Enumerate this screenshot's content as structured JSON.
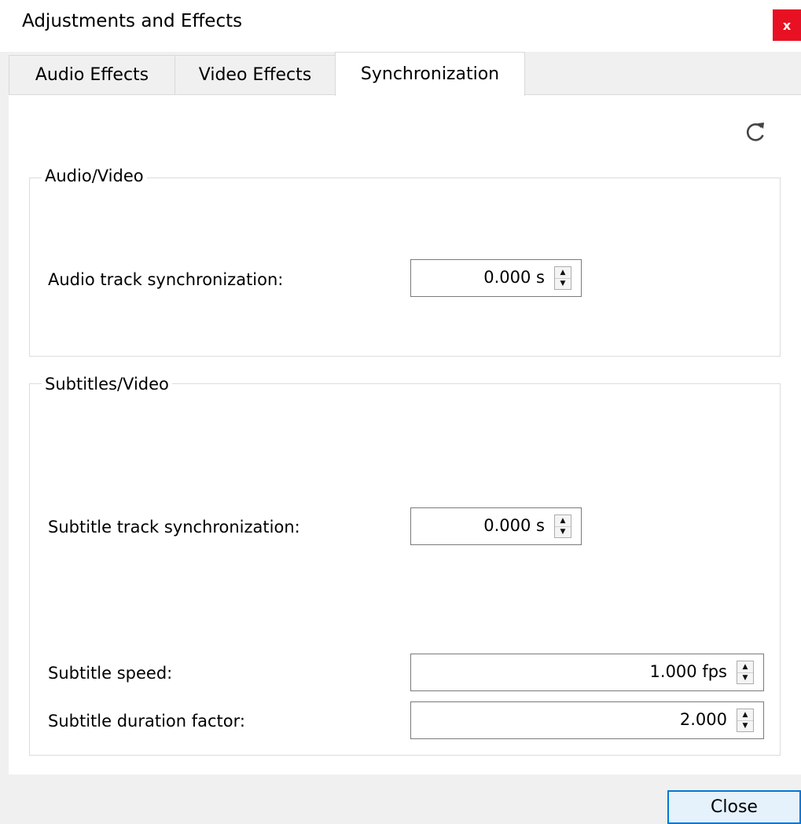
{
  "window": {
    "title": "Adjustments and Effects",
    "close_glyph": "x"
  },
  "tabs": [
    {
      "label": "Audio Effects"
    },
    {
      "label": "Video Effects"
    },
    {
      "label": "Synchronization",
      "active": true
    }
  ],
  "reset_icon": "reset-icon",
  "audio_video": {
    "group_title": "Audio/Video",
    "audio_sync_label": "Audio track synchronization:",
    "audio_sync_value": "0.000 s"
  },
  "subtitles_video": {
    "group_title": "Subtitles/Video",
    "subtitle_sync_label": "Subtitle track synchronization:",
    "subtitle_sync_value": "0.000 s",
    "subtitle_speed_label": "Subtitle speed:",
    "subtitle_speed_value": "1.000 fps",
    "duration_factor_label": "Subtitle duration factor:",
    "duration_factor_value": "2.000"
  },
  "footer": {
    "close_label": "Close"
  },
  "colors": {
    "accent": "#0078d7",
    "close_red": "#e81123"
  }
}
